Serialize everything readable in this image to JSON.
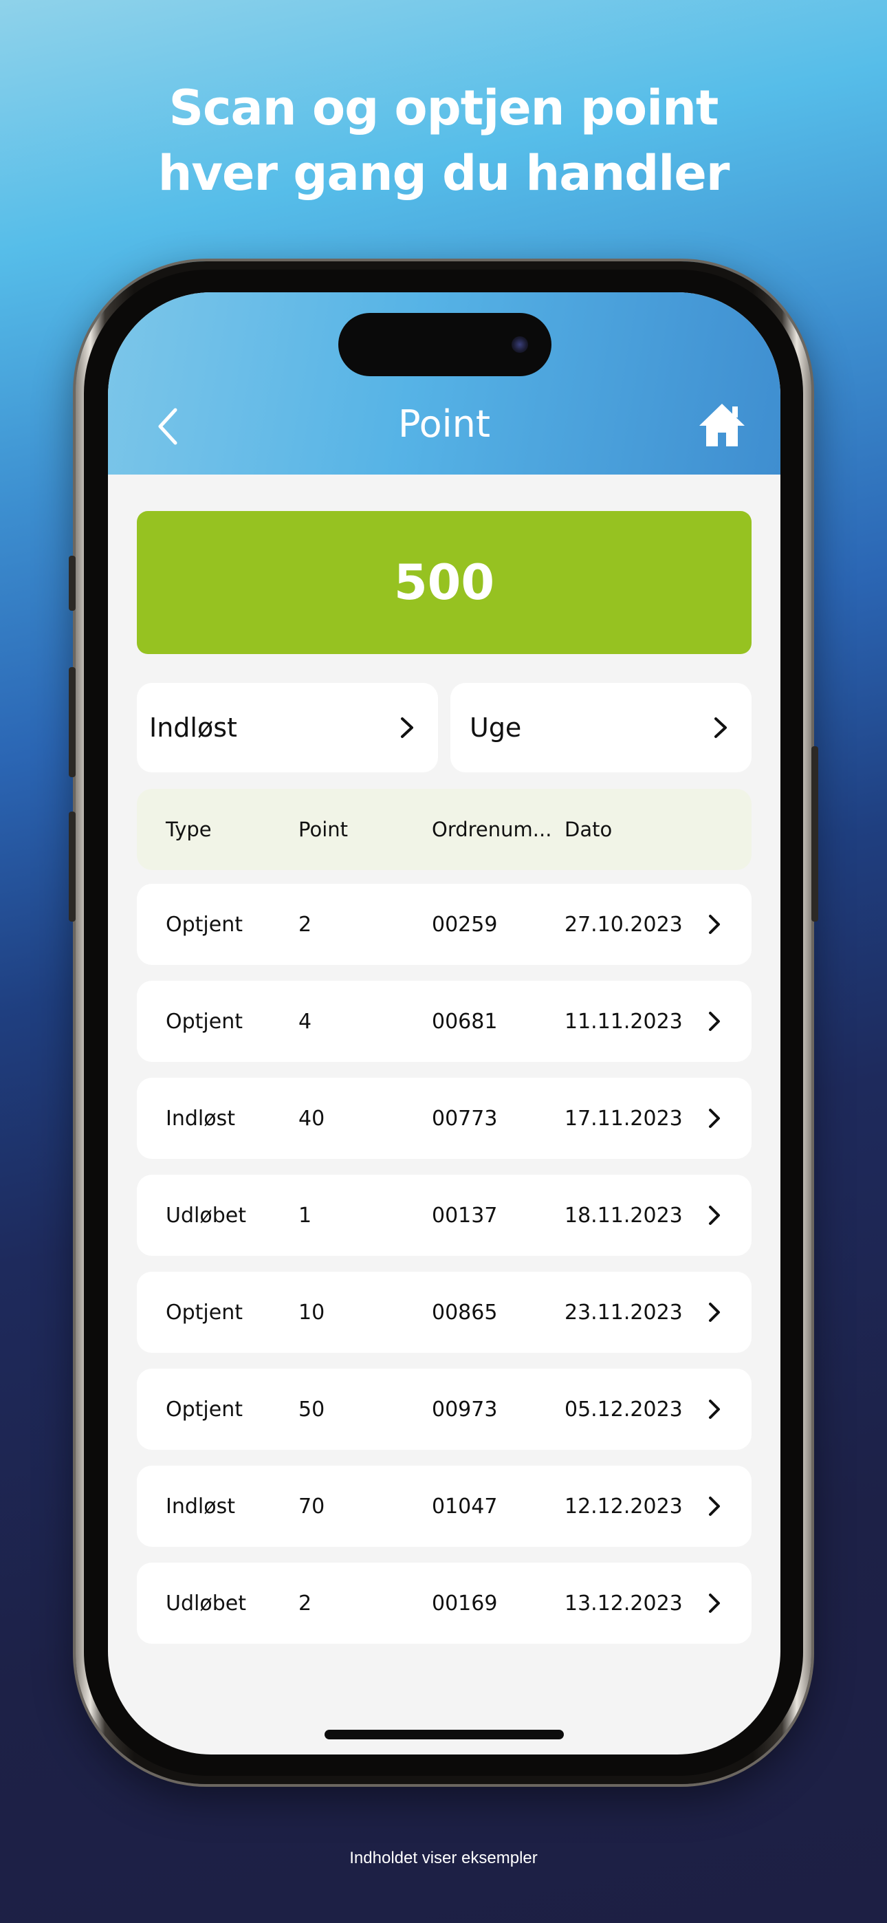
{
  "headline": {
    "line1": "Scan og optjen point",
    "line2": "hver gang du handler"
  },
  "app": {
    "title": "Point",
    "back_icon": "chevron-left-icon",
    "home_icon": "home-icon"
  },
  "points": {
    "balance": "500"
  },
  "filters": [
    {
      "label": "Indløst",
      "icon": "chevron-right-icon"
    },
    {
      "label": "Uge",
      "icon": "chevron-right-icon"
    }
  ],
  "table": {
    "headers": [
      "Type",
      "Point",
      "Ordrenum...",
      "Dato"
    ],
    "rows": [
      {
        "type": "Optjent",
        "point": "2",
        "order": "00259",
        "date": "27.10.2023"
      },
      {
        "type": "Optjent",
        "point": "4",
        "order": "00681",
        "date": "11.11.2023"
      },
      {
        "type": "Indløst",
        "point": "40",
        "order": "00773",
        "date": "17.11.2023"
      },
      {
        "type": "Udløbet",
        "point": "1",
        "order": "00137",
        "date": "18.11.2023"
      },
      {
        "type": "Optjent",
        "point": "10",
        "order": "00865",
        "date": "23.11.2023"
      },
      {
        "type": "Optjent",
        "point": "50",
        "order": "00973",
        "date": "05.12.2023"
      },
      {
        "type": "Indløst",
        "point": "70",
        "order": "01047",
        "date": "12.12.2023"
      },
      {
        "type": "Udløbet",
        "point": "2",
        "order": "00169",
        "date": "13.12.2023"
      }
    ]
  },
  "footer": {
    "note": "Indholdet viser eksempler"
  },
  "colors": {
    "points_card": "#96c221",
    "table_header_bg": "#f1f4e7",
    "header_gradient_start": "#7cc6e9",
    "header_gradient_end": "#3f8ed0"
  }
}
